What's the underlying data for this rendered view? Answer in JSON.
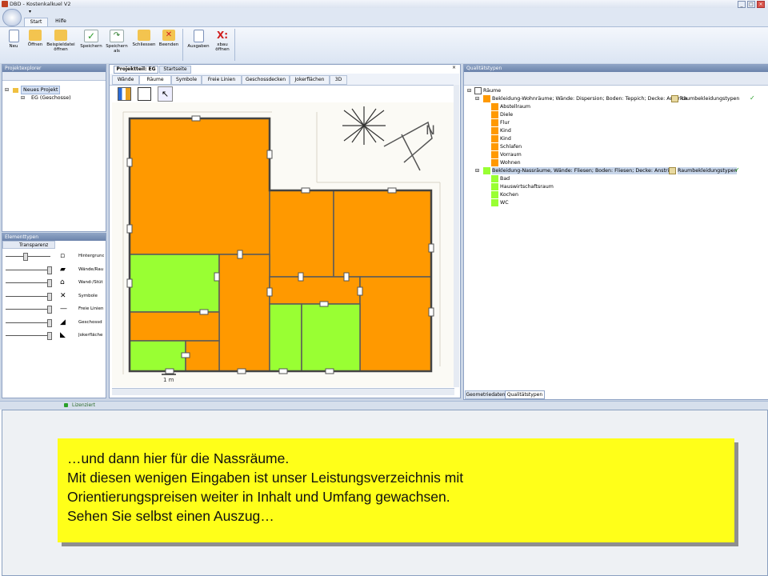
{
  "window": {
    "title": "DBD - Kostenkalkuel V2"
  },
  "ribbon": {
    "tabs": [
      "Start",
      "Hilfe"
    ],
    "buttons": [
      {
        "label": "Neu",
        "icon": "new-document-icon"
      },
      {
        "label": "Öffnen",
        "icon": "open-folder-icon"
      },
      {
        "label": "Beispieldatei öffnen",
        "icon": "open-sample-icon"
      },
      {
        "label": "Speichern",
        "icon": "save-check-icon"
      },
      {
        "label": "Speichern als",
        "icon": "save-as-icon"
      },
      {
        "label": "Schliessen",
        "icon": "close-folder-icon"
      },
      {
        "label": "Beenden",
        "icon": "exit-icon"
      },
      {
        "label": "Ausgaben",
        "icon": "output-document-icon"
      },
      {
        "label": "xbau öffnen",
        "icon": "xbau-icon"
      }
    ]
  },
  "project_explorer": {
    "title": "Projektexplorer",
    "tree": [
      "Neues Projekt",
      "EG (Geschosse)"
    ]
  },
  "element_types": {
    "title": "Elementtypen",
    "column": "Transparenz",
    "items": [
      "Hintergrund",
      "Wände/Rau",
      "Wand-/Stüt",
      "Symbole",
      "Freie Linien",
      "Geschossd",
      "Jokerfläche"
    ]
  },
  "doc_tabs": [
    "Projektteil: EG",
    "Startseite"
  ],
  "view_tabs": [
    "Wände",
    "Räume",
    "Symbole",
    "Freie Linien",
    "Geschossdecken",
    "Jokerflächen",
    "3D"
  ],
  "plan": {
    "scale_label": "1 m"
  },
  "quality_panel": {
    "title": "Qualitätstypen",
    "root": "Räume",
    "groups": [
      {
        "label": "Bekleidung-Wohnräume; Wände: Dispersion; Boden: Teppich; Decke: Anstrich",
        "type": "Raumbekleidungstypen",
        "color": "#ff9900",
        "rooms": [
          "Abstellraum",
          "Diele",
          "Flur",
          "Kind",
          "Kind",
          "Schlafen",
          "Vorraum",
          "Wohnen"
        ]
      },
      {
        "label": "Bekleidung-Nassräume, Wände: Fliesen; Boden: Fliesen; Decke: Anstrich",
        "type": "Raumbekleidungstypen",
        "color": "#99ff33",
        "rooms": [
          "Bad",
          "Hauswirtschaftsraum",
          "Kochen",
          "WC"
        ]
      }
    ],
    "bottom_tabs": [
      "Geometriedaten",
      "Qualitätstypen"
    ]
  },
  "status": {
    "text": "Lizenziert"
  },
  "callout": {
    "lines": [
      "…und dann hier für die Nassräume.",
      "Mit diesen wenigen Eingaben ist unser Leistungsverzeichnis mit",
      "Orientierungspreisen weiter in Inhalt und Umfang gewachsen.",
      "Sehen Sie selbst einen Auszug…"
    ]
  },
  "colors": {
    "wohn": "#ff9900",
    "nass": "#99ff33",
    "callout": "#ffff19"
  }
}
